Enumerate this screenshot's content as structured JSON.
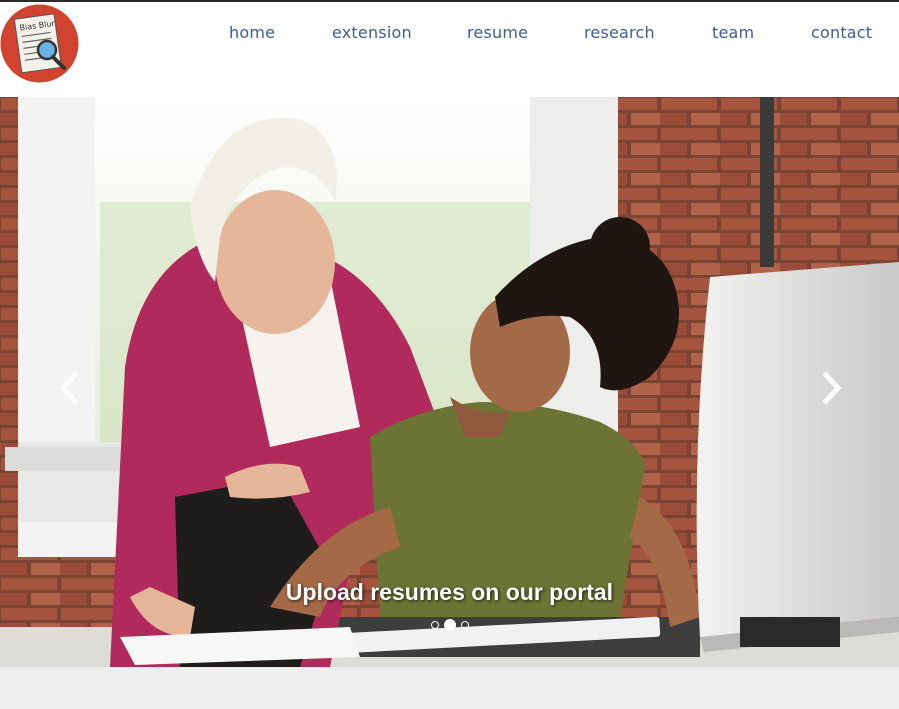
{
  "logo": {
    "text": "Bias Blur",
    "icon": "magnifier-document-icon",
    "background_color": "#d2432f"
  },
  "nav": {
    "items": [
      {
        "label": "home"
      },
      {
        "label": "extension"
      },
      {
        "label": "resume"
      },
      {
        "label": "research"
      },
      {
        "label": "team"
      },
      {
        "label": "contact"
      }
    ],
    "link_color": "#3e5f8a"
  },
  "carousel": {
    "caption": "Upload resumes on our portal",
    "prev_icon": "chevron-left-icon",
    "next_icon": "chevron-right-icon",
    "slide_count": 3,
    "active_slide": 2
  },
  "colors": {
    "footer_band": "#eeeeee",
    "top_border": "#2b2b2b"
  }
}
